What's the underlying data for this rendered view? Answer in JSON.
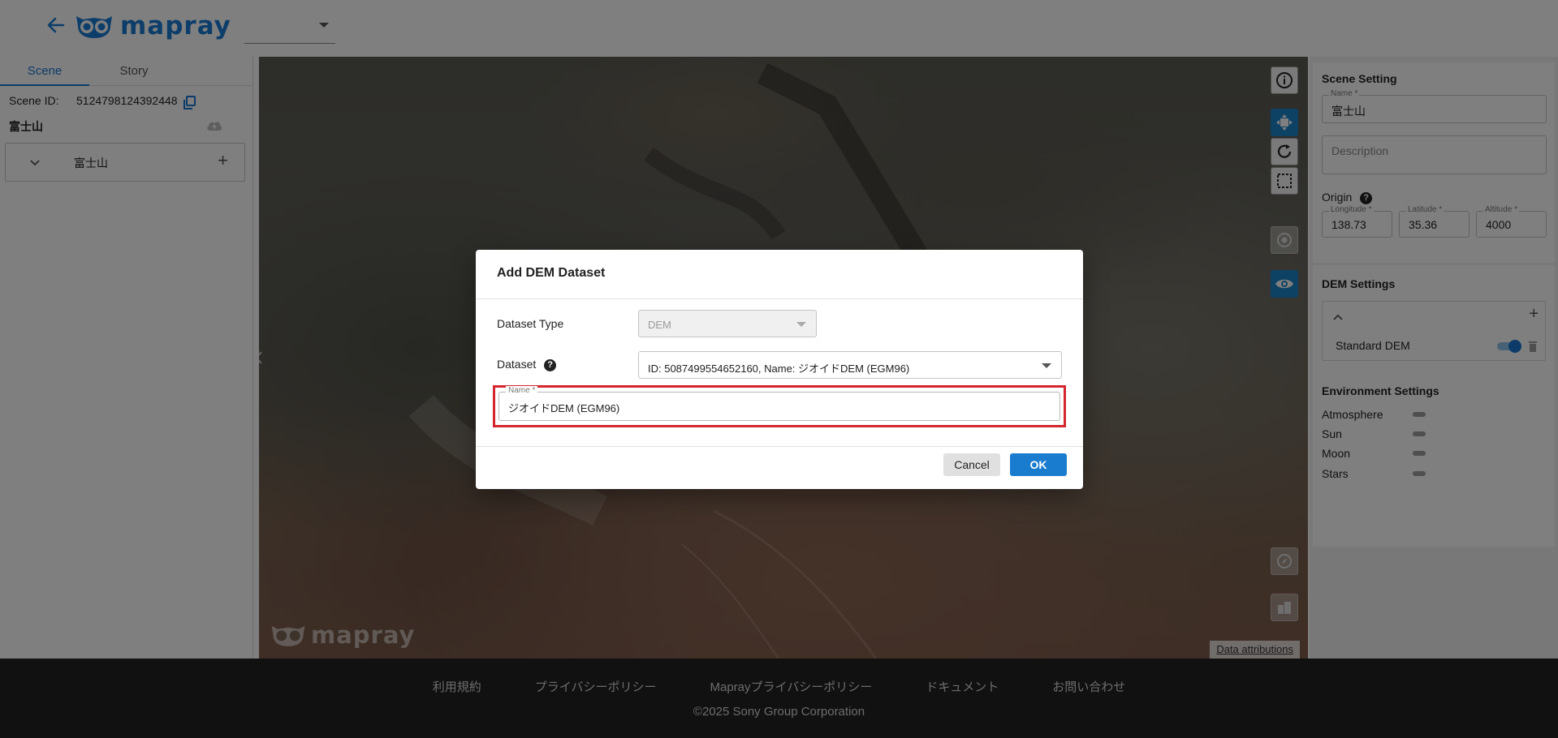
{
  "header": {
    "logo_text": "mapray",
    "scene_select_value": ""
  },
  "left_panel": {
    "tabs": [
      {
        "label": "Scene"
      },
      {
        "label": "Story"
      }
    ],
    "scene_id_label": "Scene ID:",
    "scene_id_value": "5124798124392448",
    "scene_name": "富士山",
    "layers": [
      {
        "label": "富士山"
      }
    ],
    "add_symbol": "+"
  },
  "map": {
    "watermark": "mapray",
    "attribution": "Data attributions"
  },
  "right_panel": {
    "scene_setting": {
      "title": "Scene Setting",
      "name_label": "Name *",
      "name_value": "富士山",
      "description_placeholder": "Description",
      "origin_label": "Origin",
      "longitude_label": "Longitude *",
      "longitude_value": "138.73",
      "latitude_label": "Latitude *",
      "latitude_value": "35.36",
      "altitude_label": "Altitude *",
      "altitude_value": "4000"
    },
    "dem_settings": {
      "title": "DEM Settings",
      "items": [
        {
          "label": "Standard DEM",
          "enabled": true
        }
      ]
    },
    "environment_settings": {
      "title": "Environment Settings",
      "items": [
        {
          "label": "Atmosphere",
          "enabled": false
        },
        {
          "label": "Sun",
          "enabled": false
        },
        {
          "label": "Moon",
          "enabled": false
        },
        {
          "label": "Stars",
          "enabled": false
        }
      ]
    }
  },
  "dialog": {
    "title": "Add DEM Dataset",
    "dataset_type_label": "Dataset Type",
    "dataset_type_value": "DEM",
    "dataset_label": "Dataset",
    "dataset_value": "ID: 5087499554652160, Name: ジオイドDEM (EGM96)",
    "name_label": "Name *",
    "name_value": "ジオイドDEM (EGM96)",
    "cancel_label": "Cancel",
    "ok_label": "OK"
  },
  "footer": {
    "links": [
      {
        "label": "利用規約"
      },
      {
        "label": "プライバシーポリシー"
      },
      {
        "label": "Maprayプライバシーポリシー"
      },
      {
        "label": "ドキュメント"
      },
      {
        "label": "お問い合わせ"
      }
    ],
    "copyright": "©2025 Sony Group Corporation"
  },
  "colors": {
    "brand_blue": "#1b7dd4",
    "accent_blue": "#1976d2",
    "highlight_red": "#d3262e",
    "footer_bg": "#222222"
  },
  "icons": [
    "arrow-left-icon",
    "owl-logo-icon",
    "copy-icon",
    "cloud-upload-icon",
    "chevron-down-icon",
    "plus-icon",
    "info-icon",
    "move-icon",
    "rotate-icon",
    "select-area-icon",
    "target-icon",
    "eye-icon",
    "compass-icon",
    "building-icon",
    "help-icon",
    "chevron-up-icon",
    "trash-icon",
    "chevron-left-icon"
  ]
}
